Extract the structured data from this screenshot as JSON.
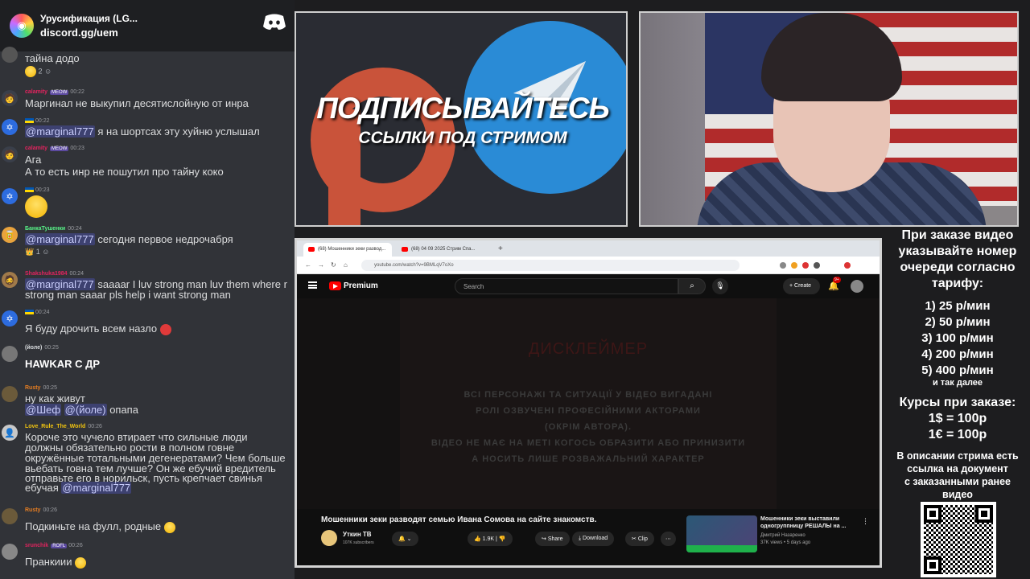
{
  "discord": {
    "server_name": "Урусификация (LG...",
    "invite": "discord.gg/uem"
  },
  "messages": [
    {
      "text": "тайна додо",
      "reactions": "2"
    },
    {
      "user": "calamity",
      "badge": "MEOW",
      "time": "00:22",
      "user_color": "#e0245e",
      "text": "Маргинал не выкупил десятислойную от инра"
    },
    {
      "user": "🇺🇦",
      "time": "00:22",
      "user_color": "#e0245e",
      "mention": "@marginal777",
      "text": "я на шортсах эту хуйню услышал"
    },
    {
      "user": "calamity",
      "badge": "MEOW",
      "time": "00:23",
      "user_color": "#e0245e",
      "text": "Ага",
      "text2": "А то есть инр не пошутил про тайну коко"
    },
    {
      "user": "🇺🇦",
      "time": "00:23",
      "user_color": "#e0245e"
    },
    {
      "user": "БанкаТушенки",
      "time": "00:24",
      "user_color": "#57f287",
      "mention": "@marginal777",
      "text": "сегодня первое недрочабря",
      "reactions": "1"
    },
    {
      "user": "Shakshuka1984",
      "time": "00:24",
      "user_color": "#e0245e",
      "mention": "@marginal777",
      "text": "saaaar I luv strong man luv them where r",
      "text2": "strong man saaar pls help i want strong man"
    },
    {
      "user": "🇺🇦",
      "time": "00:24",
      "user_color": "#e0245e",
      "text": "Я буду дрочить всем назло"
    },
    {
      "user": "(йоле)",
      "time": "00:25",
      "user_color": "#dbdee1",
      "text": "HAWKAR С ДР"
    },
    {
      "user": "Rusty",
      "time": "00:25",
      "user_color": "#e67e22",
      "text": "ну как живут",
      "mention_a": "@Шеф",
      "mention_b": "@(йоле)",
      "text2": "опапа"
    },
    {
      "user": "Love_Rule_The_World",
      "time": "00:26",
      "user_color": "#f1c40f",
      "lines": [
        "Короче это чучело втирает что сильные люди",
        "должны обязательно рости в полном говне",
        "окружённые тотальными дегенератами? Чем больше",
        "вьебать говна тем лучше? Он же ебучий вредитель",
        "  отправьте его в норильск, пусть крепчает свинья",
        "ебучая"
      ],
      "mention": "@marginal777"
    },
    {
      "user": "Rusty",
      "time": "00:26",
      "user_color": "#e67e22",
      "text": "Подкиньте на фулл, родные"
    },
    {
      "user": "srunchik",
      "badge": "ROFL",
      "time": "00:26",
      "user_color": "#e0245e",
      "text": "Пранкиии"
    }
  ],
  "promo": {
    "headline": "ПОДПИСЫВАЙТЕСЬ",
    "subline": "ССЫЛКИ ПОД СТРИМОМ"
  },
  "browser": {
    "tab1": "(68) Мошенники зеки развод...",
    "tab2": "(68) 04 09 2025 Стрим Спа...",
    "url": "youtube.com/watch?v=9BMLqV7oXo"
  },
  "youtube": {
    "brand": "Premium",
    "search_placeholder": "Search",
    "create_label": "Create",
    "notif_count": "9+",
    "warning_title": "ДИСКЛЕЙМЕР",
    "warning_lines": [
      "ВСІ ПЕРСОНАЖІ ТА СИТУАЦІЇ У ВІДЕО ВИГАДАНІ",
      "РОЛІ ОЗВУЧЕНІ ПРОФЕСІЙНИМИ АКТОРАМИ",
      "(ОКРІМ АВТОРА).",
      "ВІДЕО НЕ МАЄ НА МЕТІ КОГОСЬ ОБРАЗИТИ АБО ПРИНИЗИТИ",
      "А НОСИТЬ ЛИШЕ РОЗВАЖАЛЬНИЙ ХАРАКТЕР"
    ],
    "video_title": "Мошенники зеки разводят семью Ивана Сомова на сайте знакомств.",
    "channel_name": "Уткин ТВ",
    "channel_subs": "107K subscribers",
    "likes": "1.9K",
    "share_label": "Share",
    "download_label": "Download",
    "clip_label": "Clip",
    "rec_title": "Мошенники зеки выставили одногруппницу РЕШАЛЫ на ...",
    "rec_channel": "Дмитрий Назаренко",
    "rec_stats": "37K views • 5 days ago"
  },
  "info": {
    "h1": "При заказе видео",
    "h2": "указывайте номер",
    "h3": "очереди согласно",
    "h4": "тарифу:",
    "p1": "1) 25 р/мин",
    "p2": "2) 50 р/мин",
    "p3": "3) 100 р/мин",
    "p4": "4) 200 р/мин",
    "p5": "5) 400 р/мин",
    "more": "и так далее",
    "c1": "Курсы при заказе:",
    "c2": "1$ = 100р",
    "c3": "1€ = 100р",
    "d1": "В описании стрима есть",
    "d2": "ссылка на документ",
    "d3": "с заказанными ранее",
    "d4": "видео"
  }
}
